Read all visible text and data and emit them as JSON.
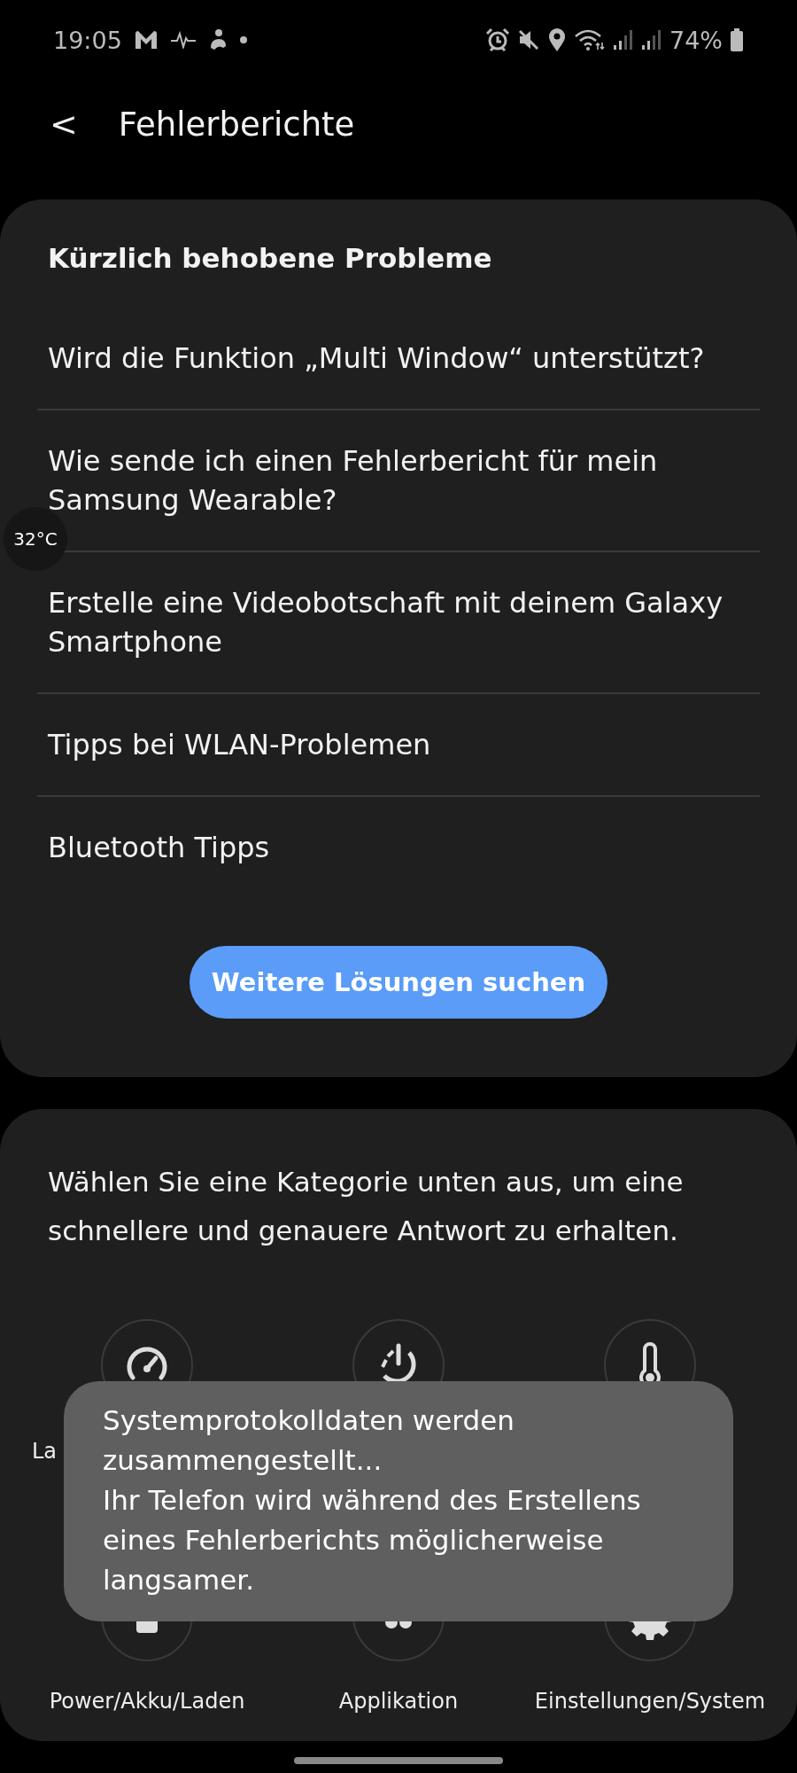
{
  "status_bar": {
    "time": "19:05",
    "battery": "74%"
  },
  "header": {
    "back": "<",
    "title": "Fehlerberichte"
  },
  "temperature_bubble": "32°C",
  "recent_issues": {
    "heading": "Kürzlich behobene Probleme",
    "items": [
      "Wird die Funktion „Multi Window“ unterstützt?",
      "Wie sende ich einen Fehlerbericht für mein Samsung Wearable?",
      "Erstelle eine Videobotschaft mit deinem Galaxy Smartphone",
      "Tipps bei WLAN-Problemen",
      "Bluetooth Tipps"
    ],
    "button": "Weitere Lösungen suchen"
  },
  "categories": {
    "intro": "Wählen Sie eine Kategorie unten aus, um eine schnellere und genauere Antwort zu erhalten.",
    "items": [
      {
        "kind": "speed",
        "label": "La"
      },
      {
        "kind": "restart"
      },
      {
        "kind": "heat"
      },
      {
        "kind": "battery",
        "label": "Power/Akku/Laden"
      },
      {
        "kind": "apps",
        "label": "Applikation"
      },
      {
        "kind": "settings",
        "label": "Einstellungen/System"
      }
    ]
  },
  "toast": {
    "lines": [
      "Systemprotokolldaten werden zusammengestellt...",
      "Ihr Telefon wird während des Erstellens eines Fehlerberichts möglicherweise langsamer."
    ]
  }
}
